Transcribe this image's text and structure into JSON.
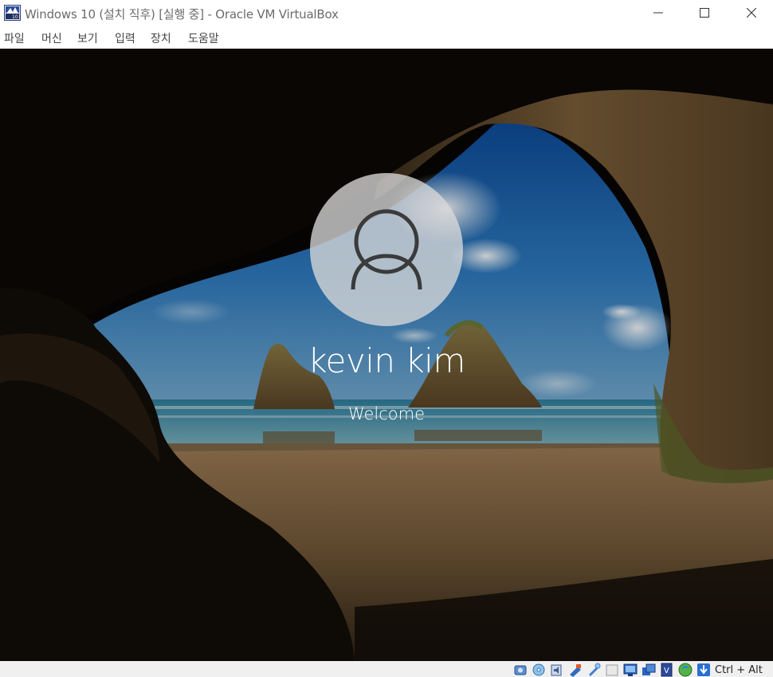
{
  "window": {
    "title": "Windows 10 (설치 직후) [실행 중] - Oracle VM VirtualBox",
    "minimize_icon": "minimize-icon",
    "maximize_icon": "maximize-icon",
    "close_icon": "close-icon"
  },
  "menu": {
    "items": [
      {
        "label": "파일"
      },
      {
        "label": "머신"
      },
      {
        "label": "보기"
      },
      {
        "label": "입력"
      },
      {
        "label": "장치"
      },
      {
        "label": "도움말"
      }
    ]
  },
  "vm_screen": {
    "user_icon": "user-avatar-icon",
    "username": "kevin kim",
    "status": "Welcome",
    "avatar_color": "#d8d8d8"
  },
  "statusbar": {
    "icons": [
      "hard-disk-icon",
      "optical-drive-icon",
      "audio-icon",
      "network-icon",
      "usb-icon",
      "shared-folders-icon",
      "display-icon",
      "video-capture-icon",
      "virtualization-icon",
      "cpu-icon",
      "mouse-integration-icon"
    ],
    "host_key": "Ctrl + Alt"
  }
}
